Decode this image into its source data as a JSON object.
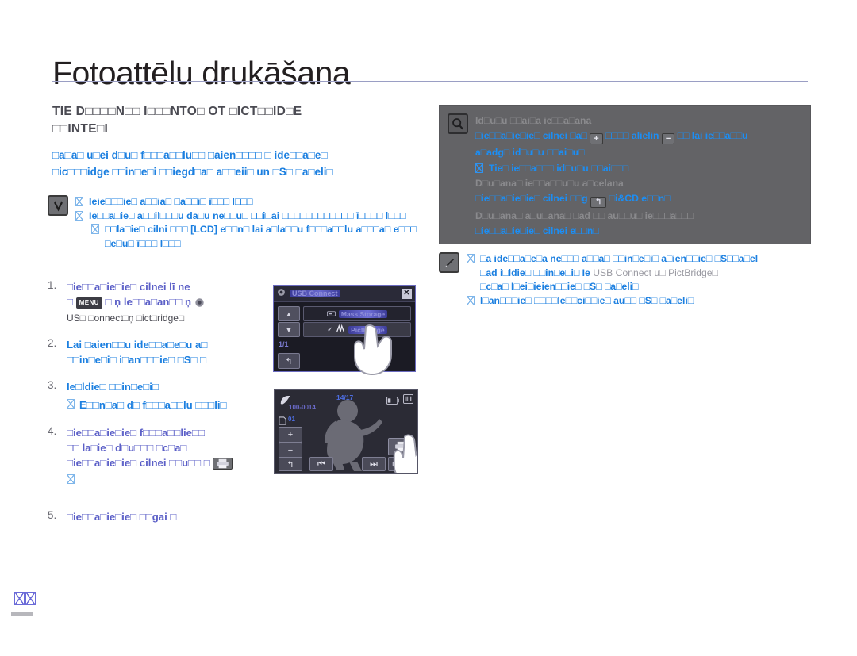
{
  "document": {
    "title": "Fotoattēlu drukāšana",
    "page_number": "□□"
  },
  "section": {
    "heading_line1": "TIE D□□□□N□□ I□□□NTO□ OT □ICT□□ID□E",
    "heading_line2": "□□INTE□I",
    "intro_line1": "□a□a□ u□ei d□u□ f□□□a□□lu□□ □aien□□□□ □ ide□□a□e□",
    "intro_line2": "□ic□□□idge □□in□e□i □□iegd□a□ a□□eii□ un □S□ □a□eli□"
  },
  "check_note": {
    "icon": "check-v-icon",
    "items": [
      "Ieie□□□ie□ a□□ia□ □a□□i□ ī□□□ l□□□",
      "Ie□□a□ie□ a□□il□□□u da□u ne□□u□ □□i□ai □□□□□□□□□□□□ ī□□□□ l□□□",
      "□□la□ie□ cilni □□□ [LCD] e□□n□ lai a□la□□u f□□□a□□lu a□□□a□ e□□□ □e□u□ ī□□□ l□□□"
    ]
  },
  "steps": [
    {
      "num": "1.",
      "line1": "□ie□□a□ie□ie□ cilnei lī ne",
      "line2_pre": "□",
      "line2_menu": "MENU",
      "line2_post": "□ ņ le□□a□an□□ ņ",
      "sub": "US□ □onnect□ņ □ict□ridge□",
      "color": "indigo"
    },
    {
      "num": "2.",
      "line1": "Lai □aien□□u ide□□a□e□u a□",
      "line2": "□□in□e□i□ i□an□□□ie□ □S□ □",
      "color": "blue"
    },
    {
      "num": "3.",
      "line1": "Ie□ldie□ □□in□e□i□",
      "subitems": [
        "E□□n□a□ d□ f□□□a□□lu □□□li□"
      ],
      "color": "blue"
    },
    {
      "num": "4.",
      "line1": "□ie□□a□ie□ie□ f□□□a□□lie□□",
      "line2": "□□ la□ie□ d□u□□□ □c□a□",
      "line3": "□ie□□a□ie□ie□ cilnei □□u□□ □",
      "subitems": [
        "□"
      ],
      "color": "indigo"
    },
    {
      "num": "5.",
      "line1": "□ie□□a□ie□ie□ □□gai □",
      "color": "indigo"
    }
  ],
  "gray_panel": {
    "icon": "magnifier-icon",
    "rows": [
      {
        "style": "grey",
        "text": "Id□u□u □□ai□a ie□□a□ana"
      },
      {
        "style": "blue",
        "text_a": "□ie□□a□ie□ie□ cilnei □a□",
        "btn_a": "+",
        "text_b": "□□□□ alielin",
        "btn_b": "−",
        "text_c": "□□ lai ie□□a□□u"
      },
      {
        "style": "blue",
        "text": "a□adg□ id□u□u □□ai□u□"
      },
      {
        "style": "blue",
        "bullet": true,
        "text": "Tie□ ie□□a□□□ id□u□u □□ai□□□"
      },
      {
        "style": "grey",
        "text": "D□u□ana□ ie□□a□□u□u a□celana"
      },
      {
        "style": "blue",
        "text_a": "□ie□□a□ie□ie□ cilnei □□g",
        "btn_a": "↰",
        "text_c": "□i&CD e□□n□"
      },
      {
        "style": "grey",
        "text": "D□u□ana□ a□u□ana□ □ad □□ au□□u□ ie□□□a□□□"
      },
      {
        "style": "blue",
        "text_a": "□ie□□a□ie□ie□",
        "text_c": "cilnei e□□n□"
      }
    ]
  },
  "pencil_note": {
    "icon": "pencil-icon",
    "items": [
      {
        "line1": "□a ide□□a□e□a ne□□□ a□□a□ □□in□e□i□ a□ien□□ie□ □S□□a□el",
        "line2_a": "□ad i□ldie□ □□in□e□i□ Ie",
        "line2_grey": "USB Connect u□ PictBridge□",
        "line3": "□c□a□ I□ei□ieien□□ie□ □S□ □a□eli□"
      },
      {
        "line1": "I□an□□□ie□ □□□□le□□ci□□ie□ au□□ □S□ □a□eli□"
      }
    ]
  },
  "device_usb": {
    "title": "USB Connect",
    "page_indicator": "1/1",
    "option1": "Mass Storage",
    "option2": "PictBridge",
    "up_icon": "chevron-up-icon",
    "down_icon": "chevron-down-icon",
    "back_icon": "return-arrow-icon",
    "close_icon": "close-icon",
    "gear_icon": "gear-icon"
  },
  "device_playback": {
    "counter": "14/17",
    "file_name": "100-0014",
    "folder_number": "01",
    "menu_label": "MENU",
    "prev_icon": "skip-back-icon",
    "next_icon": "skip-forward-icon",
    "plus_label": "+",
    "minus_label": "−",
    "back_icon": "return-arrow-icon",
    "print_icon": "printer-icon",
    "battery_icon": "battery-icon",
    "card_icon": "memory-card-icon"
  },
  "colors": {
    "accent_blue": "#1b7fe0",
    "indigo": "#5b5fc7",
    "heading_grey": "#4a4a52",
    "panel_grey": "#636366",
    "rule": "#9a9ec4"
  }
}
